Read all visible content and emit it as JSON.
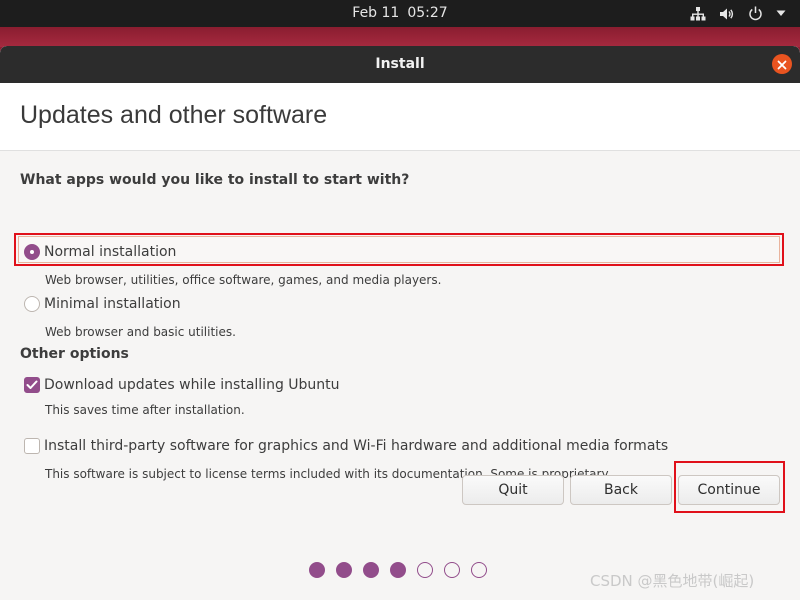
{
  "topbar": {
    "date": "Feb 11",
    "time": "05:27",
    "icons": [
      "network-icon",
      "volume-icon",
      "power-icon",
      "chevron-down-icon"
    ]
  },
  "window": {
    "title": "Install",
    "close_icon": "close-icon",
    "accent": "#e95420"
  },
  "page": {
    "title": "Updates and other software",
    "question": "What apps would you like to install to start with?",
    "install_options": [
      {
        "label": "Normal installation",
        "description": "Web browser, utilities, office software, games, and media players.",
        "selected": true
      },
      {
        "label": "Minimal installation",
        "description": "Web browser and basic utilities.",
        "selected": false
      }
    ],
    "other_options_heading": "Other options",
    "other_options": [
      {
        "label": "Download updates while installing Ubuntu",
        "description": "This saves time after installation.",
        "checked": true
      },
      {
        "label": "Install third-party software for graphics and Wi-Fi hardware and additional media formats",
        "description": "This software is subject to license terms included with its documentation. Some is proprietary.",
        "checked": false
      }
    ]
  },
  "buttons": {
    "quit": "Quit",
    "back": "Back",
    "continue": "Continue"
  },
  "progress": {
    "completed_steps": 4,
    "total_steps": 7,
    "color": "#924d8b"
  },
  "highlight_color": "#e0101a",
  "watermark": "CSDN @黑色地带(崛起)"
}
